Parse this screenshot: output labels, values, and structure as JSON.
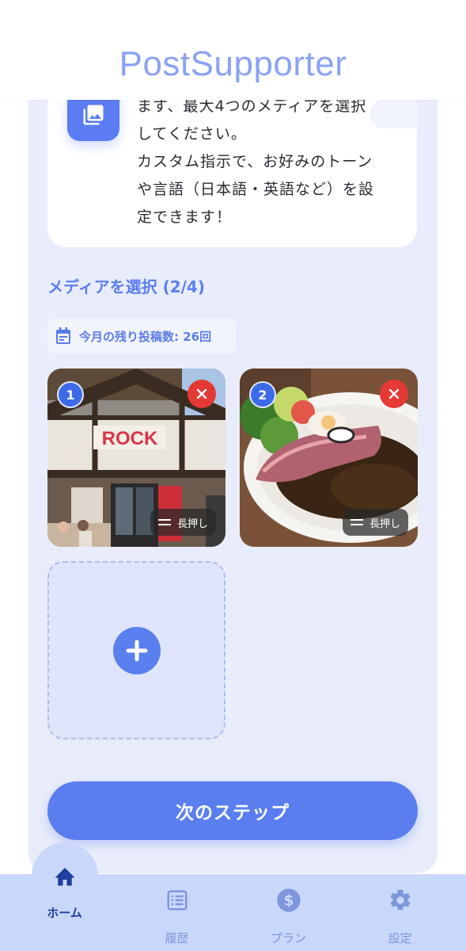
{
  "app": {
    "title": "PostSupporter"
  },
  "info": {
    "lines": [
      "ます、最大4つのメディアを選択",
      "してください。",
      "カスタム指示で、お好みのトーン",
      "や言語（日本語・英語など）を設",
      "定できます！"
    ],
    "icon": "photo-library-icon"
  },
  "media": {
    "section_title": "メディアを選択 (2/4)",
    "quota_text": "今月の残り投稿数: 26回",
    "items": [
      {
        "number": "1",
        "drag_label": "長押し"
      },
      {
        "number": "2",
        "drag_label": "長押し"
      }
    ]
  },
  "actions": {
    "next_label": "次のステップ"
  },
  "tabs": [
    {
      "label": "ホーム",
      "icon": "home-icon",
      "active": true
    },
    {
      "label": "履歴",
      "icon": "list-icon",
      "active": false
    },
    {
      "label": "プラン",
      "icon": "dollar-icon",
      "active": false
    },
    {
      "label": "設定",
      "icon": "gear-icon",
      "active": false
    }
  ],
  "colors": {
    "accent": "#5a7ef0",
    "tabbar": "#c9d8fa",
    "remove": "#e53935",
    "active_tab": "#1f3f9e",
    "inactive_tab": "#7e96dc"
  }
}
